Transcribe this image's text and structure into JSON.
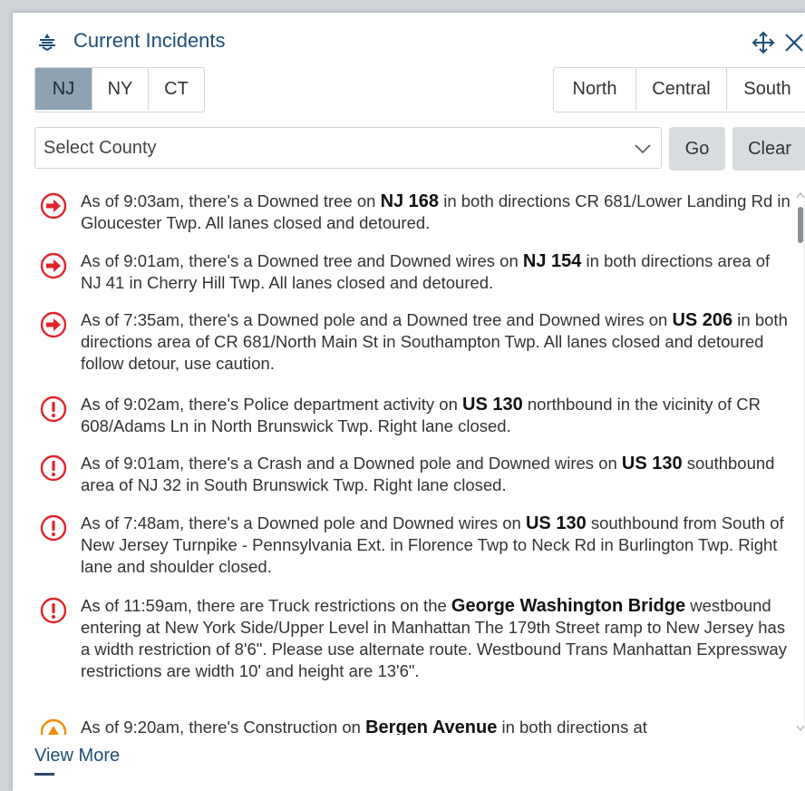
{
  "header": {
    "title": "Current Incidents"
  },
  "state_tabs": [
    {
      "label": "NJ",
      "active": true
    },
    {
      "label": "NY",
      "active": false
    },
    {
      "label": "CT",
      "active": false
    }
  ],
  "region_tabs": [
    {
      "label": "North"
    },
    {
      "label": "Central"
    },
    {
      "label": "South"
    }
  ],
  "county_select": {
    "value": "Select County"
  },
  "buttons": {
    "go": "Go",
    "clear": "Clear"
  },
  "colors": {
    "accent": "#1f4e79",
    "alert": "#e0242b",
    "warning": "#f28c00",
    "active_tab": "#8ea2b3"
  },
  "incidents": [
    {
      "icon": "arrow-circle-icon",
      "pre": "As of 9:03am, there's a Downed tree on ",
      "road": "NJ 168",
      "post": " in both directions CR 681/Lower Landing Rd in Gloucester Twp. All lanes closed and detoured."
    },
    {
      "icon": "arrow-circle-icon",
      "pre": "As of 9:01am, there's a Downed tree and Downed wires on ",
      "road": "NJ 154",
      "post": " in both directions area of NJ 41 in Cherry Hill Twp. All lanes closed and detoured."
    },
    {
      "icon": "arrow-circle-icon",
      "pre": "As of 7:35am, there's a Downed pole and a Downed tree and Downed wires on ",
      "road": "US 206",
      "post": " in both directions area of CR 681/North Main St in Southampton Twp. All lanes closed and detoured follow detour, use caution."
    },
    {
      "icon": "exclamation-circle-icon",
      "pre": "As of 9:02am, there's Police department activity on ",
      "road": "US 130",
      "post": " northbound in the vicinity of CR 608/Adams Ln in North Brunswick Twp. Right lane closed."
    },
    {
      "icon": "exclamation-circle-icon",
      "pre": "As of 9:01am, there's a Crash and a Downed pole and Downed wires on ",
      "road": "US 130",
      "post": " southbound area of NJ 32 in South Brunswick Twp. Right lane closed."
    },
    {
      "icon": "exclamation-circle-icon",
      "pre": "As of 7:48am, there's a Downed pole and Downed wires on ",
      "road": "US 130",
      "post": " southbound from South of New Jersey Turnpike - Pennsylvania Ext. in Florence Twp to Neck Rd in Burlington Twp. Right lane and shoulder closed."
    },
    {
      "icon": "exclamation-circle-icon",
      "pre": "As of 11:59am, there are Truck restrictions on the ",
      "road": "George Washington Bridge",
      "post": " westbound entering at New York Side/Upper Level in Manhattan The 179th Street ramp to New Jersey has a width restriction of 8'6\". Please use alternate route. Westbound Trans Manhattan Expressway restrictions are width 10' and height are 13'6\"."
    },
    {
      "icon": "construction-icon",
      "pre": "As of 9:20am, there's Construction on ",
      "road": "Bergen Avenue",
      "post": " in both directions at"
    }
  ],
  "view_more": "View More"
}
